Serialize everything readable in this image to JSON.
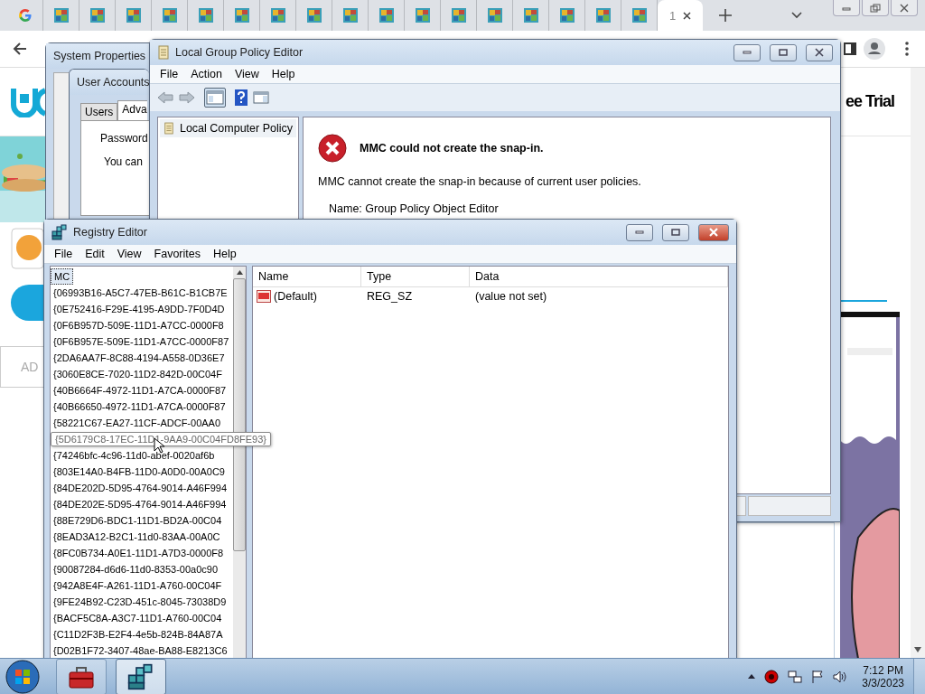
{
  "browser": {
    "tabs": [
      {
        "kind": "google",
        "selected": false
      },
      {
        "kind": "site",
        "selected": false
      },
      {
        "kind": "site",
        "selected": false
      },
      {
        "kind": "site",
        "selected": false
      },
      {
        "kind": "site",
        "selected": false
      },
      {
        "kind": "site",
        "selected": false
      },
      {
        "kind": "site",
        "selected": false
      },
      {
        "kind": "site",
        "selected": false
      },
      {
        "kind": "site",
        "selected": false
      },
      {
        "kind": "site",
        "selected": false
      },
      {
        "kind": "site",
        "selected": false
      },
      {
        "kind": "site",
        "selected": false
      },
      {
        "kind": "site",
        "selected": false
      },
      {
        "kind": "site",
        "selected": false
      },
      {
        "kind": "site",
        "selected": false
      },
      {
        "kind": "site",
        "selected": false
      },
      {
        "kind": "site",
        "selected": false
      },
      {
        "kind": "site",
        "selected": false
      },
      {
        "kind": "text",
        "label": "1",
        "selected": true
      }
    ],
    "page": {
      "trial_text": "ee Trial",
      "field_placeholder": "AD"
    }
  },
  "system_properties": {
    "title": "System Properties"
  },
  "user_accounts": {
    "title": "User Accounts",
    "tabs": [
      {
        "label": "Users",
        "selected": false
      },
      {
        "label": "Adva",
        "selected": true
      }
    ],
    "group": "Password",
    "text": "You can"
  },
  "group_policy_editor": {
    "title": "Local Group Policy Editor",
    "menu": [
      "File",
      "Action",
      "View",
      "Help"
    ],
    "tree": [
      {
        "label": "Local Computer Policy"
      }
    ],
    "error": {
      "heading": "MMC could not create the snap-in.",
      "message": "MMC cannot create the snap-in because of current user policies.",
      "detail": "Name: Group Policy Object Editor"
    }
  },
  "registry_editor": {
    "title": "Registry Editor",
    "menu": [
      "File",
      "Edit",
      "View",
      "Favorites",
      "Help"
    ],
    "tree": [
      {
        "kind": "key",
        "label": "MC",
        "selected": true
      },
      {
        "kind": "key",
        "label": "{06993B16-A5C7-47EB-B61C-B1CB7E",
        "selected": false
      },
      {
        "kind": "key",
        "label": "{0E752416-F29E-4195-A9DD-7F0D4D",
        "selected": false
      },
      {
        "kind": "key",
        "label": "{0F6B957D-509E-11D1-A7CC-0000F8",
        "selected": false
      },
      {
        "kind": "key",
        "label": "{0F6B957E-509E-11D1-A7CC-0000F87",
        "selected": false
      },
      {
        "kind": "key",
        "label": "{2DA6AA7F-8C88-4194-A558-0D36E7",
        "selected": false
      },
      {
        "kind": "key",
        "label": "{3060E8CE-7020-11D2-842D-00C04F",
        "selected": false
      },
      {
        "kind": "key",
        "label": "{40B6664F-4972-11D1-A7CA-0000F87",
        "selected": false
      },
      {
        "kind": "key",
        "label": "{40B66650-4972-11D1-A7CA-0000F87",
        "selected": false
      },
      {
        "kind": "key",
        "label": "{58221C67-EA27-11CF-ADCF-00AA0",
        "selected": false
      },
      {
        "kind": "tooltip",
        "label": "{5D6179C8-17EC-11D1-9AA9-00C04FD8FE93}"
      },
      {
        "kind": "key",
        "label": "{74246bfc-4c96-11d0-abef-0020af6b",
        "selected": false
      },
      {
        "kind": "key",
        "label": "{803E14A0-B4FB-11D0-A0D0-00A0C9",
        "selected": false
      },
      {
        "kind": "key",
        "label": "{84DE202D-5D95-4764-9014-A46F994",
        "selected": false
      },
      {
        "kind": "key",
        "label": "{84DE202E-5D95-4764-9014-A46F994",
        "selected": false
      },
      {
        "kind": "key",
        "label": "{88E729D6-BDC1-11D1-BD2A-00C04",
        "selected": false
      },
      {
        "kind": "key",
        "label": "{8EAD3A12-B2C1-11d0-83AA-00A0C",
        "selected": false
      },
      {
        "kind": "key",
        "label": "{8FC0B734-A0E1-11D1-A7D3-0000F8",
        "selected": false
      },
      {
        "kind": "key",
        "label": "{90087284-d6d6-11d0-8353-00a0c90",
        "selected": false
      },
      {
        "kind": "key",
        "label": "{942A8E4F-A261-11D1-A760-00C04F",
        "selected": false
      },
      {
        "kind": "key",
        "label": "{9FE24B92-C23D-451c-8045-73038D9",
        "selected": false
      },
      {
        "kind": "key",
        "label": "{BACF5C8A-A3C7-11D1-A760-00C04",
        "selected": false
      },
      {
        "kind": "key",
        "label": "{C11D2F3B-E2F4-4e5b-824B-84A87A",
        "selected": false
      },
      {
        "kind": "key",
        "label": "{D02B1F72-3407-48ae-BA88-E8213C6",
        "selected": false
      }
    ],
    "columns": [
      "Name",
      "Type",
      "Data"
    ],
    "rows": [
      {
        "name": "(Default)",
        "type": "REG_SZ",
        "data": "(value not set)"
      }
    ]
  },
  "taskbar": {
    "apps": [
      {
        "kind": "toolbox",
        "selected": false
      },
      {
        "kind": "registry",
        "selected": true
      }
    ],
    "time": "7:12 PM",
    "date": "3/3/2023"
  }
}
